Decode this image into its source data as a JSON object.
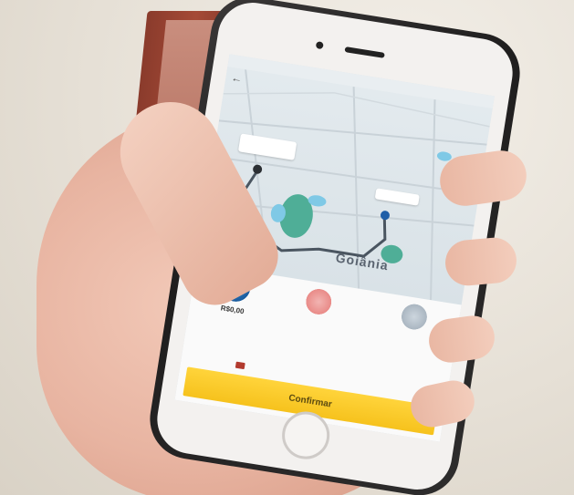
{
  "map": {
    "city_label": "Goiânia",
    "origin_label": "",
    "destination_label": ""
  },
  "options": [
    {
      "price": "R$0,00",
      "subtitle": ""
    },
    {
      "price": "",
      "subtitle": ""
    },
    {
      "price": "",
      "subtitle": ""
    }
  ],
  "confirm": {
    "label": "Confirmar"
  },
  "colors": {
    "confirm_bg": "#f6c21d",
    "route": "#4a5560",
    "park": "#4fae97"
  },
  "icons": {
    "back": "back-arrow-icon",
    "origin": "origin-pin-icon",
    "destination": "destination-pin-icon",
    "payment": "credit-card-icon"
  }
}
